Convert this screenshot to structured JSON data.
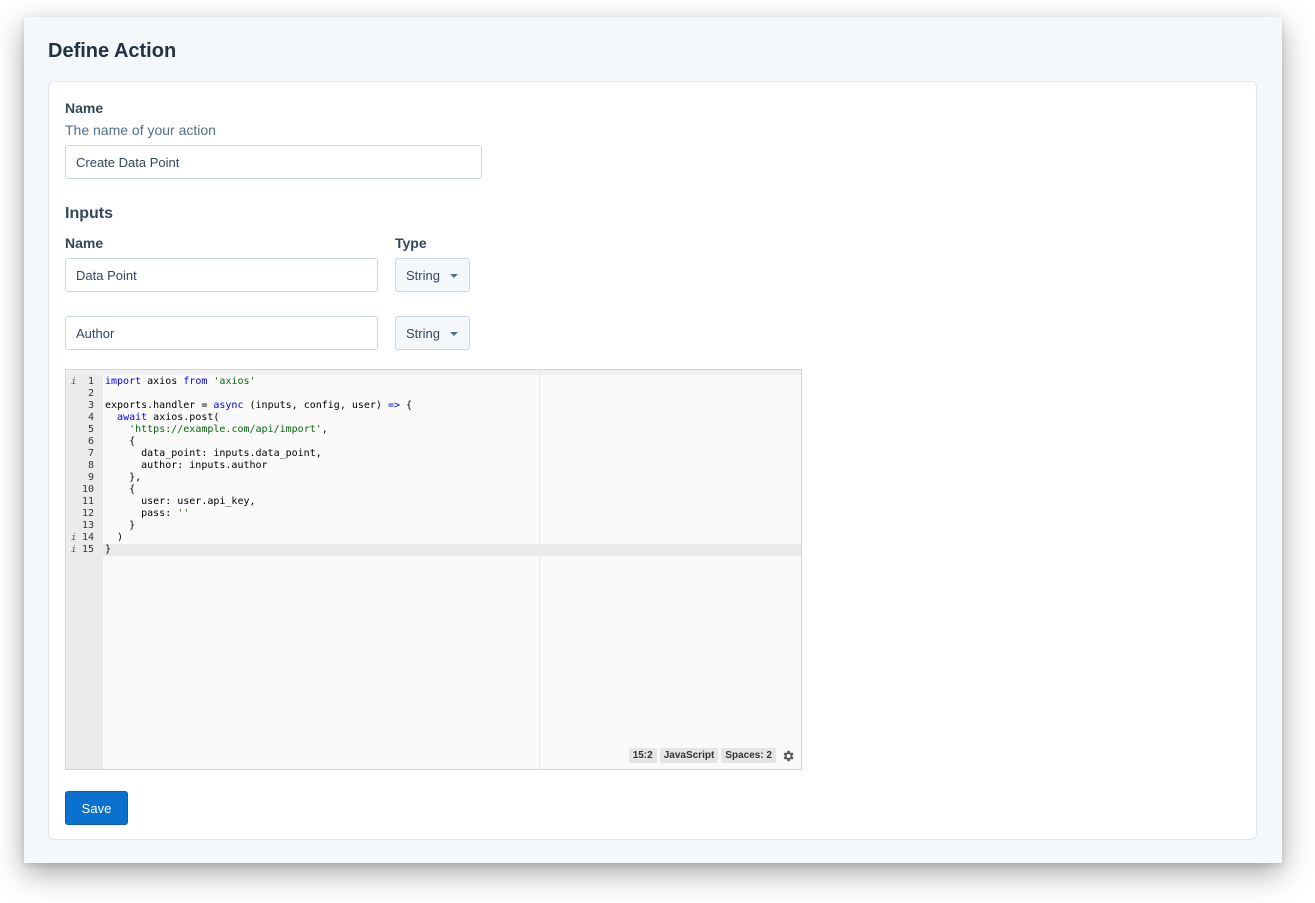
{
  "page": {
    "title": "Define Action"
  },
  "name_field": {
    "label": "Name",
    "help": "The name of your action",
    "value": "Create Data Point"
  },
  "inputs": {
    "title": "Inputs",
    "name_header": "Name",
    "type_header": "Type",
    "rows": [
      {
        "name": "Data Point",
        "type": "String"
      },
      {
        "name": "Author",
        "type": "String"
      }
    ]
  },
  "editor": {
    "annotated_lines": [
      1,
      14,
      15
    ],
    "active_line": 15,
    "lines": [
      "import axios from 'axios'",
      "",
      "exports.handler = async (inputs, config, user) => {",
      "  await axios.post(",
      "    'https://example.com/api/import',",
      "    {",
      "      data_point: inputs.data_point,",
      "      author: inputs.author",
      "    },",
      "    {",
      "      user: user.api_key,",
      "      pass: ''",
      "    }",
      "  )",
      "}"
    ],
    "status": {
      "position": "15:2",
      "mode": "JavaScript",
      "indent": "Spaces: 2"
    }
  },
  "save_button": {
    "label": "Save"
  },
  "colors": {
    "primary": "#0a72ce",
    "text": "#33475b",
    "background": "#f5f8fa"
  }
}
